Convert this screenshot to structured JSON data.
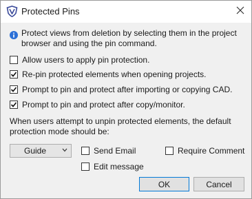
{
  "window": {
    "title": "Protected Pins",
    "close_glyph": "✕",
    "app_icon": "revit-shield-icon"
  },
  "info": {
    "icon": "info-icon",
    "text": "Protect views from deletion by selecting them in the project browser and using the pin command."
  },
  "options": [
    {
      "label": "Allow users to apply pin protection.",
      "checked": false
    },
    {
      "label": "Re-pin protected elements when opening projects.",
      "checked": true
    },
    {
      "label": "Prompt to pin and protect after importing or copying CAD.",
      "checked": true
    },
    {
      "label": "Prompt to pin and protect after copy/monitor.",
      "checked": true
    }
  ],
  "unpin_description": "When users attempt to unpin protected elements, the default protection mode should be:",
  "mode": {
    "selected": "Guide"
  },
  "mode_options": {
    "send_email": {
      "label": "Send Email",
      "checked": false
    },
    "require_comment": {
      "label": "Require Comment",
      "checked": false
    },
    "edit_message": {
      "label": "Edit message",
      "checked": false
    }
  },
  "buttons": {
    "ok": "OK",
    "cancel": "Cancel"
  },
  "colors": {
    "accent": "#0078d7",
    "info_blue": "#2b6fd6",
    "brand": "#3a4a9a"
  }
}
